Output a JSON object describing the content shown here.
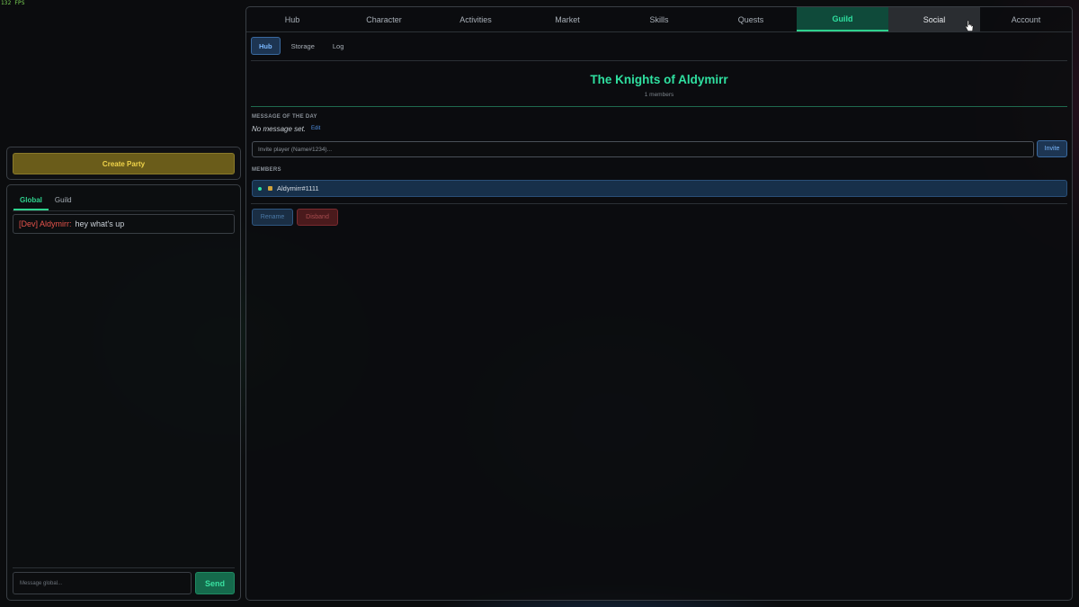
{
  "fps": "132 FPS",
  "party": {
    "create_label": "Create Party"
  },
  "chat": {
    "tabs": [
      {
        "label": "Global",
        "active": true
      },
      {
        "label": "Guild",
        "active": false
      }
    ],
    "messages": [
      {
        "author": "[Dev] Aldymirr:",
        "text": "hey what's up"
      }
    ],
    "input_placeholder": "Message global...",
    "send_label": "Send"
  },
  "nav": {
    "tabs": [
      {
        "label": "Hub"
      },
      {
        "label": "Character"
      },
      {
        "label": "Activities"
      },
      {
        "label": "Market"
      },
      {
        "label": "Skills"
      },
      {
        "label": "Quests"
      },
      {
        "label": "Guild",
        "active": true
      },
      {
        "label": "Social",
        "hovered": true
      },
      {
        "label": "Account"
      }
    ]
  },
  "guild": {
    "sub_tabs": [
      {
        "label": "Hub",
        "active": true
      },
      {
        "label": "Storage"
      },
      {
        "label": "Log"
      }
    ],
    "name": "The Knights of Aldymirr",
    "member_count": "1 members",
    "motd_label": "MESSAGE OF THE DAY",
    "motd_text": "No message set.",
    "motd_edit": "Edit",
    "invite_placeholder": "Invite player (Name#1234)...",
    "invite_label": "Invite",
    "members_label": "MEMBERS",
    "members": [
      {
        "name": "Aldymirr#1111",
        "online": true
      }
    ],
    "rename_label": "Rename",
    "disband_label": "Disband"
  },
  "colors": {
    "accent": "#2fd28e",
    "primary_blue": "#3a6aa0",
    "danger": "#7a2a2e",
    "party_gold": "#f0d44a"
  }
}
